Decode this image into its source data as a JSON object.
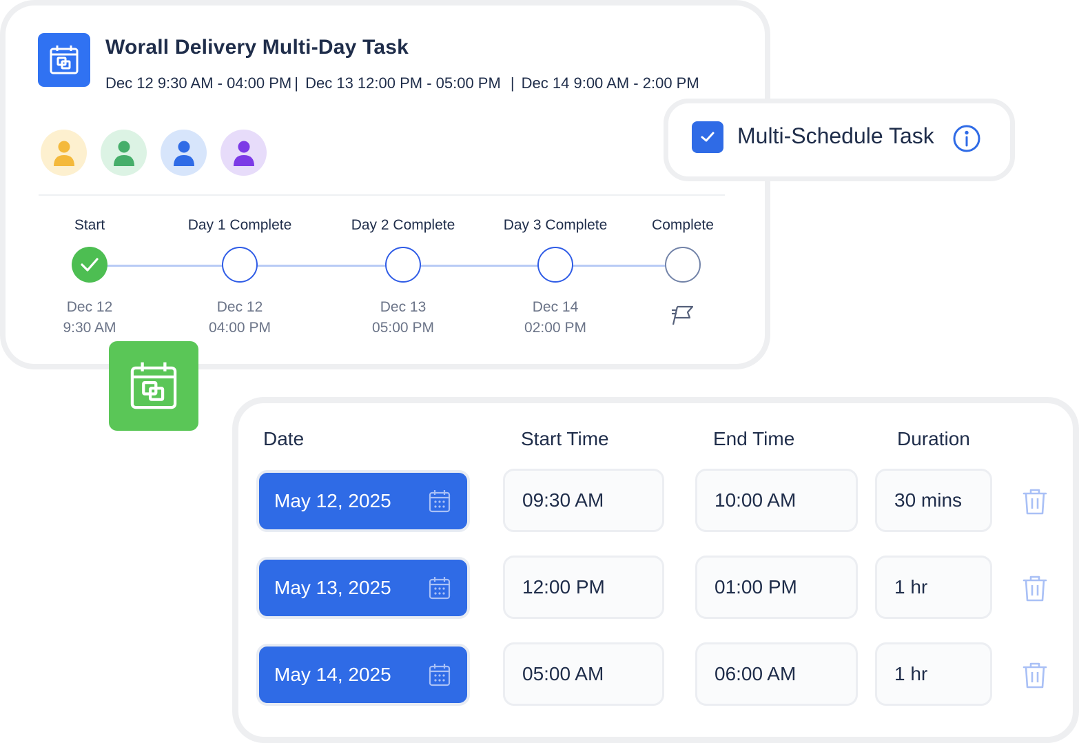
{
  "task": {
    "title": "Worall Delivery Multi-Day Task",
    "dates": [
      "Dec 12 9:30 AM - 04:00 PM",
      "Dec 13 12:00 PM - 05:00 PM",
      "Dec 14 9:00 AM - 2:00 PM"
    ],
    "separator": "|",
    "avatars": [
      {
        "name": "user-avatar-yellow",
        "bg": "#fdf0cf",
        "fg": "#f4b93b"
      },
      {
        "name": "user-avatar-green",
        "bg": "#dcf3e4",
        "fg": "#46ae6a"
      },
      {
        "name": "user-avatar-blue",
        "bg": "#d7e5fb",
        "fg": "#2f6be6"
      },
      {
        "name": "user-avatar-purple",
        "bg": "#e7dcfa",
        "fg": "#7c3ae6"
      }
    ],
    "steps": [
      {
        "label": "Start",
        "date": "Dec 12",
        "time": "9:30 AM",
        "status": "done"
      },
      {
        "label": "Day 1 Complete",
        "date": "Dec 12",
        "time": "04:00 PM",
        "status": "pending"
      },
      {
        "label": "Day 2 Complete",
        "date": "Dec 13",
        "time": "05:00 PM",
        "status": "pending"
      },
      {
        "label": "Day 3 Complete",
        "date": "Dec 14",
        "time": "02:00 PM",
        "status": "pending"
      },
      {
        "label": "Complete",
        "date": "",
        "time": "",
        "status": "final",
        "icon": "flag-icon"
      }
    ]
  },
  "multi_schedule": {
    "label": "Multi-Schedule Task",
    "checked": true,
    "info_icon": "info-icon"
  },
  "schedule": {
    "headers": {
      "date": "Date",
      "start": "Start Time",
      "end": "End Time",
      "duration": "Duration"
    },
    "rows": [
      {
        "date": "May 12, 2025",
        "start": "09:30 AM",
        "end": "10:00 AM",
        "duration": "30 mins"
      },
      {
        "date": "May 13, 2025",
        "start": "12:00 PM",
        "end": "01:00 PM",
        "duration": "1 hr"
      },
      {
        "date": "May 14, 2025",
        "start": "05:00 AM",
        "end": "06:00 AM",
        "duration": "1 hr"
      }
    ]
  },
  "colors": {
    "accent": "#2f6be6",
    "success": "#4dbe52",
    "border": "#eeeff1"
  }
}
